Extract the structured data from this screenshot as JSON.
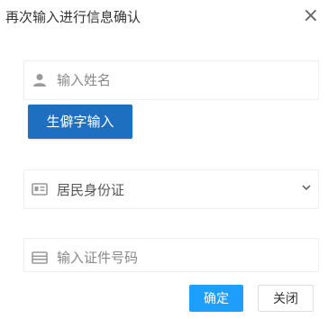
{
  "dialog": {
    "title": "再次输入进行信息确认",
    "close_glyph": "×"
  },
  "name_field": {
    "placeholder": "输入姓名",
    "icon": "user-icon"
  },
  "rare_char_button": {
    "label": "生僻字输入"
  },
  "id_type_select": {
    "selected": "居民身份证",
    "icon": "id-card-icon"
  },
  "id_number_field": {
    "placeholder": "输入证件号码",
    "icon": "card-icon"
  },
  "buttons": {
    "confirm": "确定",
    "close": "关闭"
  },
  "colors": {
    "primary": "#1e9fff",
    "rare_button": "#1e6fc0"
  }
}
